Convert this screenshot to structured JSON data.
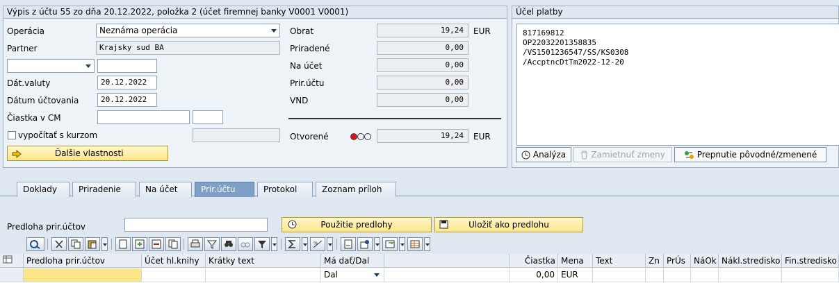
{
  "header": {
    "title": "Výpis z účtu 55 zo dňa 20.12.2022, položka 2 (účet firemnej banky V0001 V0001)"
  },
  "left": {
    "operation_label": "Operácia",
    "operation_value": "Neznáma operácia",
    "partner_label": "Partner",
    "partner_value": "Krajsky sud BA",
    "value_date_label": "Dát.valuty",
    "value_date": "20.12.2022",
    "posting_date_label": "Dátum účtovania",
    "posting_date": "20.12.2022",
    "amount_cm_label": "Čiastka v CM",
    "calc_rate_label": "vypočítať s kurzom",
    "more_props_button": "Ďalšie vlastnosti"
  },
  "middle": {
    "rows": [
      {
        "label": "Obrat",
        "value": "19,24",
        "currency": "EUR"
      },
      {
        "label": "Priradené",
        "value": "0,00",
        "currency": ""
      },
      {
        "label": "Na účet",
        "value": "0,00",
        "currency": ""
      },
      {
        "label": "Prir.účtu",
        "value": "0,00",
        "currency": ""
      },
      {
        "label": "VND",
        "value": "0,00",
        "currency": ""
      }
    ],
    "open_label": "Otvorené",
    "open_value": "19,24",
    "open_currency": "EUR"
  },
  "purpose": {
    "title": "Účel platby",
    "lines": [
      "817169812",
      "OP22032201358835",
      "/VS1501236547/SS/KS0308",
      "/AccptncDtTm2022-12-20"
    ],
    "analyze_button": "Analýza",
    "reject_button": "Zamietnuť zmeny",
    "switch_button": "Prepnutie pôvodné/zmenené"
  },
  "tabs": [
    "Doklady",
    "Priradenie",
    "Na účet",
    "Prir.účtu",
    "Protokol",
    "Zoznam príloh"
  ],
  "active_tab": "Prir.účtu",
  "template": {
    "label": "Predloha prir.účtov",
    "use_button": "Použitie predlohy",
    "save_button": "Uložiť ako predlohu"
  },
  "table": {
    "headers": [
      "Predloha prir.účtov",
      "Účet hl.knihy",
      "Krátky text",
      "Má dať/Dal",
      "",
      "Čiastka",
      "Mena",
      "Text",
      "Zn",
      "PrÚs",
      "NáOk",
      "Nákl.stredisko",
      "Fin.stredisko"
    ],
    "row": {
      "debit_credit": "Dal",
      "amount": "0,00",
      "currency": "EUR"
    }
  },
  "colors": {
    "accent_yellow": "#fbe58b",
    "active_tab": "#7fa0c6",
    "status_red": "#d9121c"
  }
}
